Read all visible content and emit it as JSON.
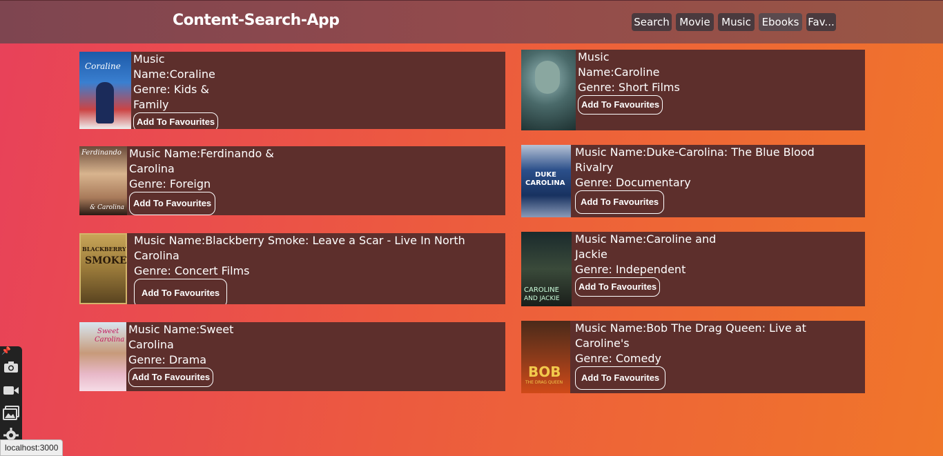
{
  "app": {
    "title": "Content-Search-App"
  },
  "nav": [
    {
      "label": "Search"
    },
    {
      "label": "Movie"
    },
    {
      "label": "Music"
    },
    {
      "label": "Ebooks"
    },
    {
      "label": "Fav..."
    }
  ],
  "fav_label": "Add To Favourites",
  "cards": [
    {
      "line1": "Music",
      "line2": "Name:Coraline",
      "genre_a": "Genre: Kids &",
      "genre_b": "Family"
    },
    {
      "line1": "Music",
      "line2": "Name:Caroline",
      "genre": "Genre: Short Films"
    },
    {
      "name_a": "Music Name:Ferdinando &",
      "name_b": "Carolina",
      "genre": "Genre: Foreign"
    },
    {
      "name_a": "Music Name:Duke-Carolina: The Blue Blood",
      "name_b": "Rivalry",
      "genre": "Genre: Documentary"
    },
    {
      "name_a": "Music Name:Blackberry Smoke: Leave a Scar - Live In North",
      "name_b": "Carolina",
      "genre": "Genre: Concert Films"
    },
    {
      "name_a": "Music Name:Caroline and",
      "name_b": "Jackie",
      "genre": "Genre: Independent"
    },
    {
      "name_a": "Music Name:Sweet",
      "name_b": "Carolina",
      "genre": "Genre: Drama"
    },
    {
      "name_a": "Music Name:Bob The Drag Queen: Live at",
      "name_b": "Caroline's",
      "genre": "Genre: Comedy"
    }
  ],
  "posters": {
    "coraline": "Coraline",
    "ferdinando_top": "Ferdinando",
    "ferdinando_bottom": "& Carolina",
    "duke_a": "DUKE",
    "duke_b": "CAROLINA",
    "smoke_a": "BLACKBERRY",
    "smoke_b": "SMOKE",
    "jackie_a": "CAROLINE",
    "jackie_b": "AND JACKIE",
    "sweet_a": "Sweet",
    "sweet_b": "Carolina",
    "bob": "BOB",
    "bob_sub": "THE DRAG QUEEN"
  },
  "status_bar": "localhost:3000",
  "icons": [
    "pin-icon",
    "camera-icon",
    "video-icon",
    "gallery-icon",
    "gear-icon"
  ]
}
